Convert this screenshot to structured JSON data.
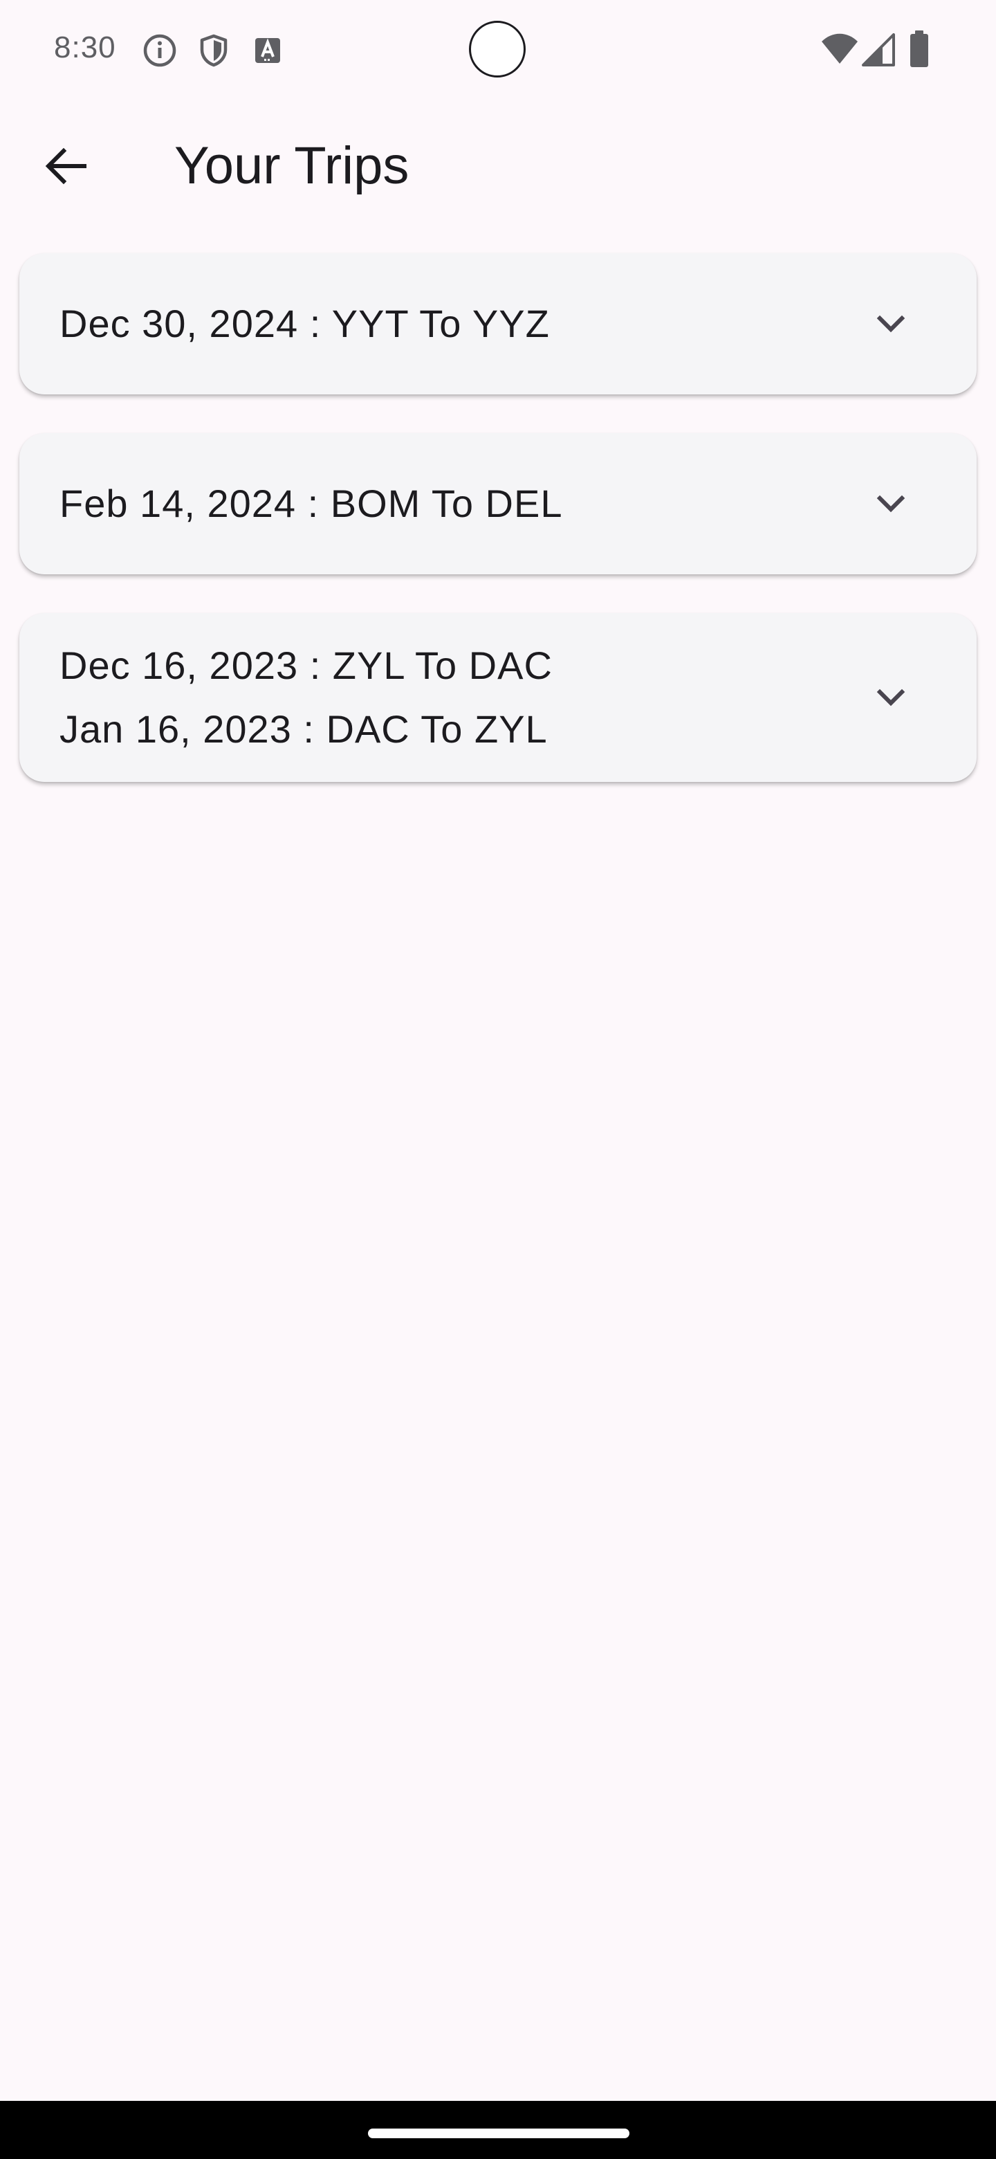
{
  "status_bar": {
    "time": "8:30",
    "left_icons": [
      "info-icon",
      "shield-icon",
      "text-a-icon"
    ],
    "right_icons": [
      "wifi-icon",
      "cellular-signal-icon",
      "battery-icon"
    ]
  },
  "app_bar": {
    "title": "Your Trips",
    "back_icon": "arrow-back-icon"
  },
  "trips": [
    {
      "lines": [
        "Dec 30, 2024 : YYT To YYZ"
      ]
    },
    {
      "lines": [
        "Feb 14, 2024 : BOM To DEL"
      ]
    },
    {
      "lines": [
        "Dec 16, 2023 : ZYL To DAC",
        "Jan 16, 2023 : DAC To ZYL"
      ]
    }
  ],
  "colors": {
    "background": "#fdf8fb",
    "card": "#f5f5f7",
    "text": "#1c1b1f",
    "nav_bar": "#000000"
  }
}
